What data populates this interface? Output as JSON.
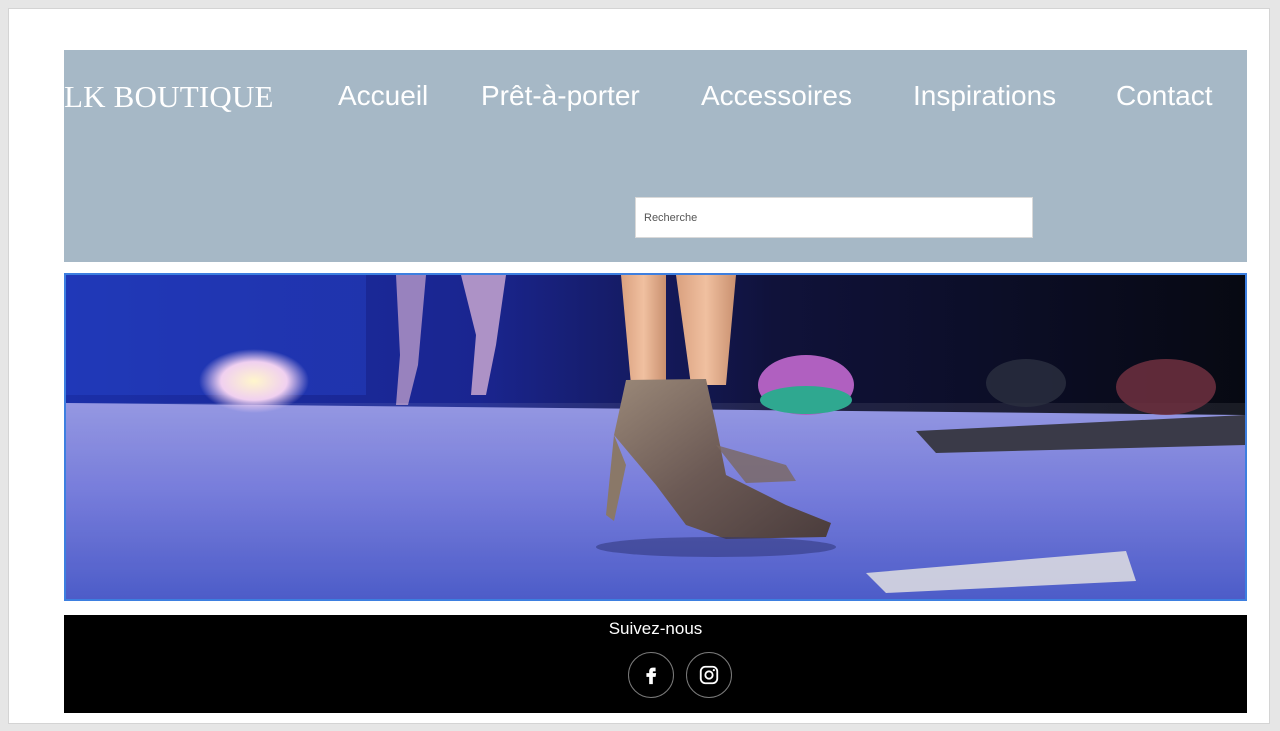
{
  "header": {
    "brand": "LK BOUTIQUE",
    "nav": [
      {
        "label": "Accueil"
      },
      {
        "label": "Prêt-à-porter"
      },
      {
        "label": "Accessoires"
      },
      {
        "label": "Inspirations"
      },
      {
        "label": "Contact"
      }
    ],
    "search": {
      "placeholder": "Recherche",
      "value": ""
    }
  },
  "hero": {
    "image": "glitter-ankle-boot-stage-photo"
  },
  "footer": {
    "follow_label": "Suivez-nous",
    "social": [
      {
        "icon": "facebook-icon"
      },
      {
        "icon": "instagram-icon"
      }
    ]
  },
  "colors": {
    "header_bg": "#a6b8c6",
    "footer_bg": "#000000",
    "hero_border": "#3d7fe0"
  }
}
